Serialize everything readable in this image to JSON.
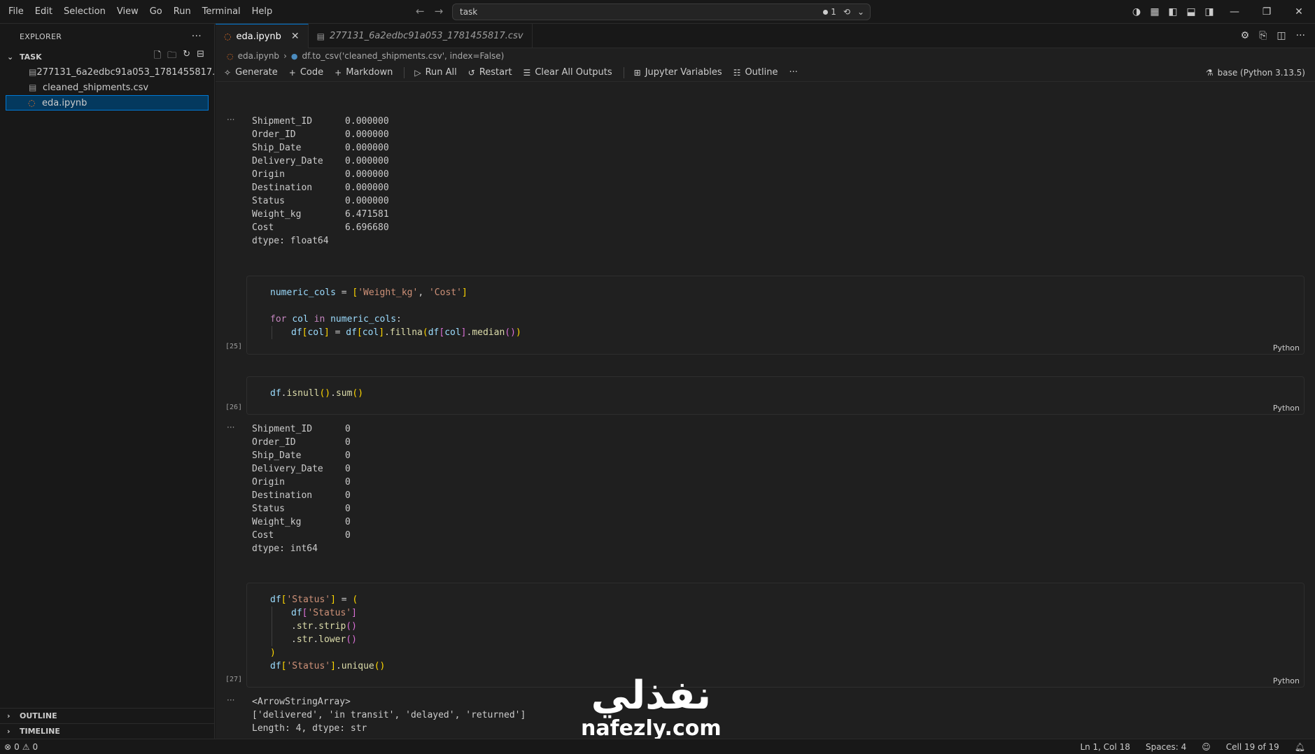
{
  "menu": [
    "File",
    "Edit",
    "Selection",
    "View",
    "Go",
    "Run",
    "Terminal",
    "Help"
  ],
  "command_center": {
    "text": "task",
    "count": "1"
  },
  "sidebar": {
    "title": "EXPLORER",
    "folder": "TASK",
    "files": [
      {
        "name": "277131_6a2edbc91a053_1781455817.csv",
        "icon": "csv-file-icon"
      },
      {
        "name": "cleaned_shipments.csv",
        "icon": "csv-file-icon"
      },
      {
        "name": "eda.ipynb",
        "icon": "notebook-icon",
        "active": true
      }
    ],
    "outline": "OUTLINE",
    "timeline": "TIMELINE"
  },
  "tabs": [
    {
      "label": "eda.ipynb",
      "active": true
    },
    {
      "label": "277131_6a2edbc91a053_1781455817.csv",
      "active": false
    }
  ],
  "breadcrumb": {
    "file": "eda.ipynb",
    "symbol": "df.to_csv('cleaned_shipments.csv', index=False)"
  },
  "toolbar": {
    "generate": "Generate",
    "code": "Code",
    "markdown": "Markdown",
    "run_all": "Run All",
    "restart": "Restart",
    "clear_outputs": "Clear All Outputs",
    "variables": "Jupyter Variables",
    "outline": "Outline",
    "kernel": "base (Python 3.13.5)"
  },
  "outputs": {
    "first": "Shipment_ID      0.000000\nOrder_ID         0.000000\nShip_Date        0.000000\nDelivery_Date    0.000000\nOrigin           0.000000\nDestination      0.000000\nStatus           0.000000\nWeight_kg        6.471581\nCost             6.696680\ndtype: float64",
    "second": "Shipment_ID      0\nOrder_ID         0\nShip_Date        0\nDelivery_Date    0\nOrigin           0\nDestination      0\nStatus           0\nWeight_kg        0\nCost             0\ndtype: int64",
    "third": "<ArrowStringArray>\n['delivered', 'in transit', 'delayed', 'returned']\nLength: 4, dtype: str"
  },
  "cells": [
    {
      "count": "[25]",
      "lang": "Python"
    },
    {
      "count": "[26]",
      "lang": "Python"
    },
    {
      "count": "[27]",
      "lang": "Python"
    }
  ],
  "watermark": {
    "arabic": "نفذلي",
    "latin": "nafezly.com"
  },
  "statusbar": {
    "errors": "0",
    "warnings": "0",
    "position": "Ln 1, Col 18",
    "spaces": "Spaces: 4",
    "cell": "Cell 19 of 19"
  }
}
